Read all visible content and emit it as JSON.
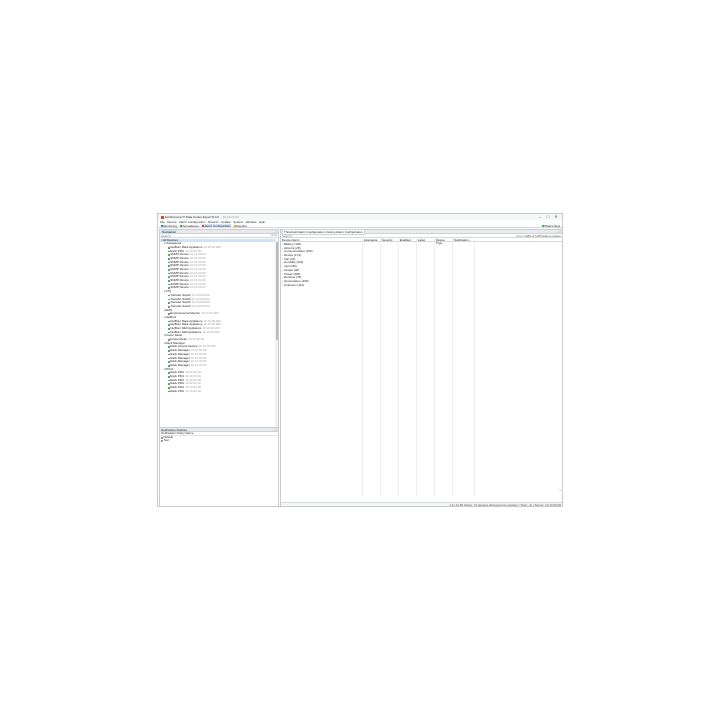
{
  "window": {
    "title": "EcoStruxure IT Data Center Expert 8.0.0",
    "title_suffix": "- 10.10.00.00",
    "controls": [
      "–",
      "□",
      "✕"
    ]
  },
  "menu": [
    "File",
    "Device",
    "Alarm Configuration",
    "Reports",
    "Update",
    "System",
    "Window",
    "Help"
  ],
  "tabs": [
    {
      "label": "Monitoring",
      "color": "#4a7fc1",
      "active": false
    },
    {
      "label": "Surveillance",
      "color": "#3c9b4a",
      "active": false
    },
    {
      "label": "Alarm Configuration",
      "color": "#d6452e",
      "active": true
    },
    {
      "label": "Reports",
      "color": "#e0a020",
      "active": false
    }
  ],
  "whats_new": "What's New",
  "navigation": {
    "title": "Navigation",
    "controls": "− □",
    "search_placeholder": "Search",
    "clear": "Clear",
    "tree": [
      {
        "indent": 0,
        "twisty": "▾",
        "label": "All Devices",
        "ip": "",
        "dot": false,
        "selected": true
      },
      {
        "indent": 1,
        "twisty": "▾",
        "label": "Unassigned",
        "ip": "",
        "dot": false
      },
      {
        "indent": 2,
        "twisty": "",
        "label": "NetBotz Rack Appliance",
        "ip": "10.10.00.000",
        "dot": true
      },
      {
        "indent": 2,
        "twisty": "",
        "label": "Rack PDU",
        "ip": "10.10.00.00",
        "dot": true
      },
      {
        "indent": 2,
        "twisty": "",
        "label": "SNMP Device",
        "ip": "10.10.00.00",
        "dot": true
      },
      {
        "indent": 2,
        "twisty": "",
        "label": "SNMP Device",
        "ip": "10.10.00.00",
        "dot": true
      },
      {
        "indent": 2,
        "twisty": "",
        "label": "SNMP Device",
        "ip": "10.10.00.00",
        "dot": true
      },
      {
        "indent": 2,
        "twisty": "",
        "label": "SNMP Device",
        "ip": "10.10.00.00",
        "dot": true
      },
      {
        "indent": 2,
        "twisty": "",
        "label": "SNMP Device",
        "ip": "10.10.00.00",
        "dot": true
      },
      {
        "indent": 2,
        "twisty": "",
        "label": "SNMP Device",
        "ip": "10.10.00.00",
        "dot": true
      },
      {
        "indent": 2,
        "twisty": "",
        "label": "SNMP Device",
        "ip": "10.10.00.00",
        "dot": true
      },
      {
        "indent": 2,
        "twisty": "",
        "label": "SNMP Device",
        "ip": "10.10.00.00",
        "dot": true
      },
      {
        "indent": 2,
        "twisty": "",
        "label": "SNMP Device",
        "ip": "10.10.00.00",
        "dot": true
      },
      {
        "indent": 2,
        "twisty": "",
        "label": "SNMP Device",
        "ip": "10.10.00.00",
        "dot": true
      },
      {
        "indent": 1,
        "twisty": "▾",
        "label": "ATS",
        "ip": "",
        "dot": false
      },
      {
        "indent": 2,
        "twisty": "",
        "label": "Transfer Switch",
        "ip": "10.10.00.000",
        "dot": true
      },
      {
        "indent": 2,
        "twisty": "",
        "label": "Transfer Switch",
        "ip": "10.10.00.000",
        "dot": true
      },
      {
        "indent": 2,
        "twisty": "",
        "label": "Transfer Switch",
        "ip": "10.10.00.000",
        "dot": true
      },
      {
        "indent": 2,
        "twisty": "",
        "label": "Transfer Switch",
        "ip": "10.10.00.000",
        "dot": true
      },
      {
        "indent": 1,
        "twisty": "▾",
        "label": "EMS",
        "ip": "",
        "dot": false
      },
      {
        "indent": 2,
        "twisty": "",
        "label": "Environmental Monitor",
        "ip": "10.10.00.000",
        "dot": true
      },
      {
        "indent": 1,
        "twisty": "▾",
        "label": "NetBotz",
        "ip": "",
        "dot": false
      },
      {
        "indent": 2,
        "twisty": "",
        "label": "NetBotz Rack Appliance",
        "ip": "10.10.00.000",
        "dot": true
      },
      {
        "indent": 2,
        "twisty": "",
        "label": "NetBotz Rack Appliance",
        "ip": "10.10.00.000",
        "dot": true
      },
      {
        "indent": 2,
        "twisty": "",
        "label": "NetBotz Wall Appliance",
        "ip": "10.10.00.000",
        "dot": true
      },
      {
        "indent": 2,
        "twisty": "",
        "label": "NetBotz Wall Appliance",
        "ip": "10.10.00.000",
        "dot": true
      },
      {
        "indent": 1,
        "twisty": "▾",
        "label": "Power Meter",
        "ip": "",
        "dot": false
      },
      {
        "indent": 2,
        "twisty": "",
        "label": "Power Meter",
        "ip": "10.10.00.00",
        "dot": true
      },
      {
        "indent": 1,
        "twisty": "▾",
        "label": "Rack Manager",
        "ip": "",
        "dot": false
      },
      {
        "indent": 2,
        "twisty": "",
        "label": "Rack Access Device",
        "ip": "10.10.00.000",
        "dot": true
      },
      {
        "indent": 2,
        "twisty": "",
        "label": "Rack Manager",
        "ip": "10.10.00.00",
        "dot": true
      },
      {
        "indent": 2,
        "twisty": "",
        "label": "Rack Manager",
        "ip": "10.10.00.00",
        "dot": true
      },
      {
        "indent": 2,
        "twisty": "",
        "label": "Rack Manager",
        "ip": "10.10.00.00",
        "dot": true
      },
      {
        "indent": 2,
        "twisty": "",
        "label": "Rack Manager",
        "ip": "10.10.00.00",
        "dot": true
      },
      {
        "indent": 2,
        "twisty": "",
        "label": "Rack Manager",
        "ip": "10.10.00.00",
        "dot": true
      },
      {
        "indent": 1,
        "twisty": "▾",
        "label": "PDUs",
        "ip": "",
        "dot": false
      },
      {
        "indent": 2,
        "twisty": "",
        "label": "Rack PDU",
        "ip": "10.10.00.00",
        "dot": true
      },
      {
        "indent": 2,
        "twisty": "",
        "label": "Rack PDU",
        "ip": "10.10.00.00",
        "dot": true
      },
      {
        "indent": 2,
        "twisty": "",
        "label": "Rack PDU",
        "ip": "10.10.00.00",
        "dot": true
      },
      {
        "indent": 2,
        "twisty": "",
        "label": "Rack PDU",
        "ip": "10.10.00.00",
        "dot": true
      },
      {
        "indent": 2,
        "twisty": "",
        "label": "Rack PDU",
        "ip": "10.10.00.00",
        "dot": true
      },
      {
        "indent": 2,
        "twisty": "",
        "label": "Rack PDU",
        "ip": "10.10.00.00",
        "dot": true
      }
    ]
  },
  "notification_policies": {
    "title": "Notification Policies",
    "controls": "− □",
    "column": "Notification Policy Name",
    "rows": [
      "Default",
      "Test"
    ]
  },
  "alarm_config": {
    "tab_title": "Threshold Alarm Configuration: Device Alarm Configuration",
    "controls": "− □",
    "search_placeholder": "Search",
    "clear": "Clear",
    "info": "1386 of 1386 alarms shown",
    "columns": [
      "Device Alarm",
      "Hostname",
      "Severity",
      "Enabled",
      "Label",
      "Device Type",
      "Notification..."
    ],
    "rows": [
      "Battery (191)",
      "Airports (28)",
      "Communication (106)",
      "Device (174)",
      "Fan (16)",
      "Humidity (116)",
      "Input (84)",
      "Output (46)",
      "Power (366)",
      "Runtime (76)",
      "Temperature (206)",
      "Unknown (112)"
    ]
  },
  "status": "1.6 / 11.56 Active: 73 devices discovered to-register / Town: up | Server: 10.10.00.00"
}
